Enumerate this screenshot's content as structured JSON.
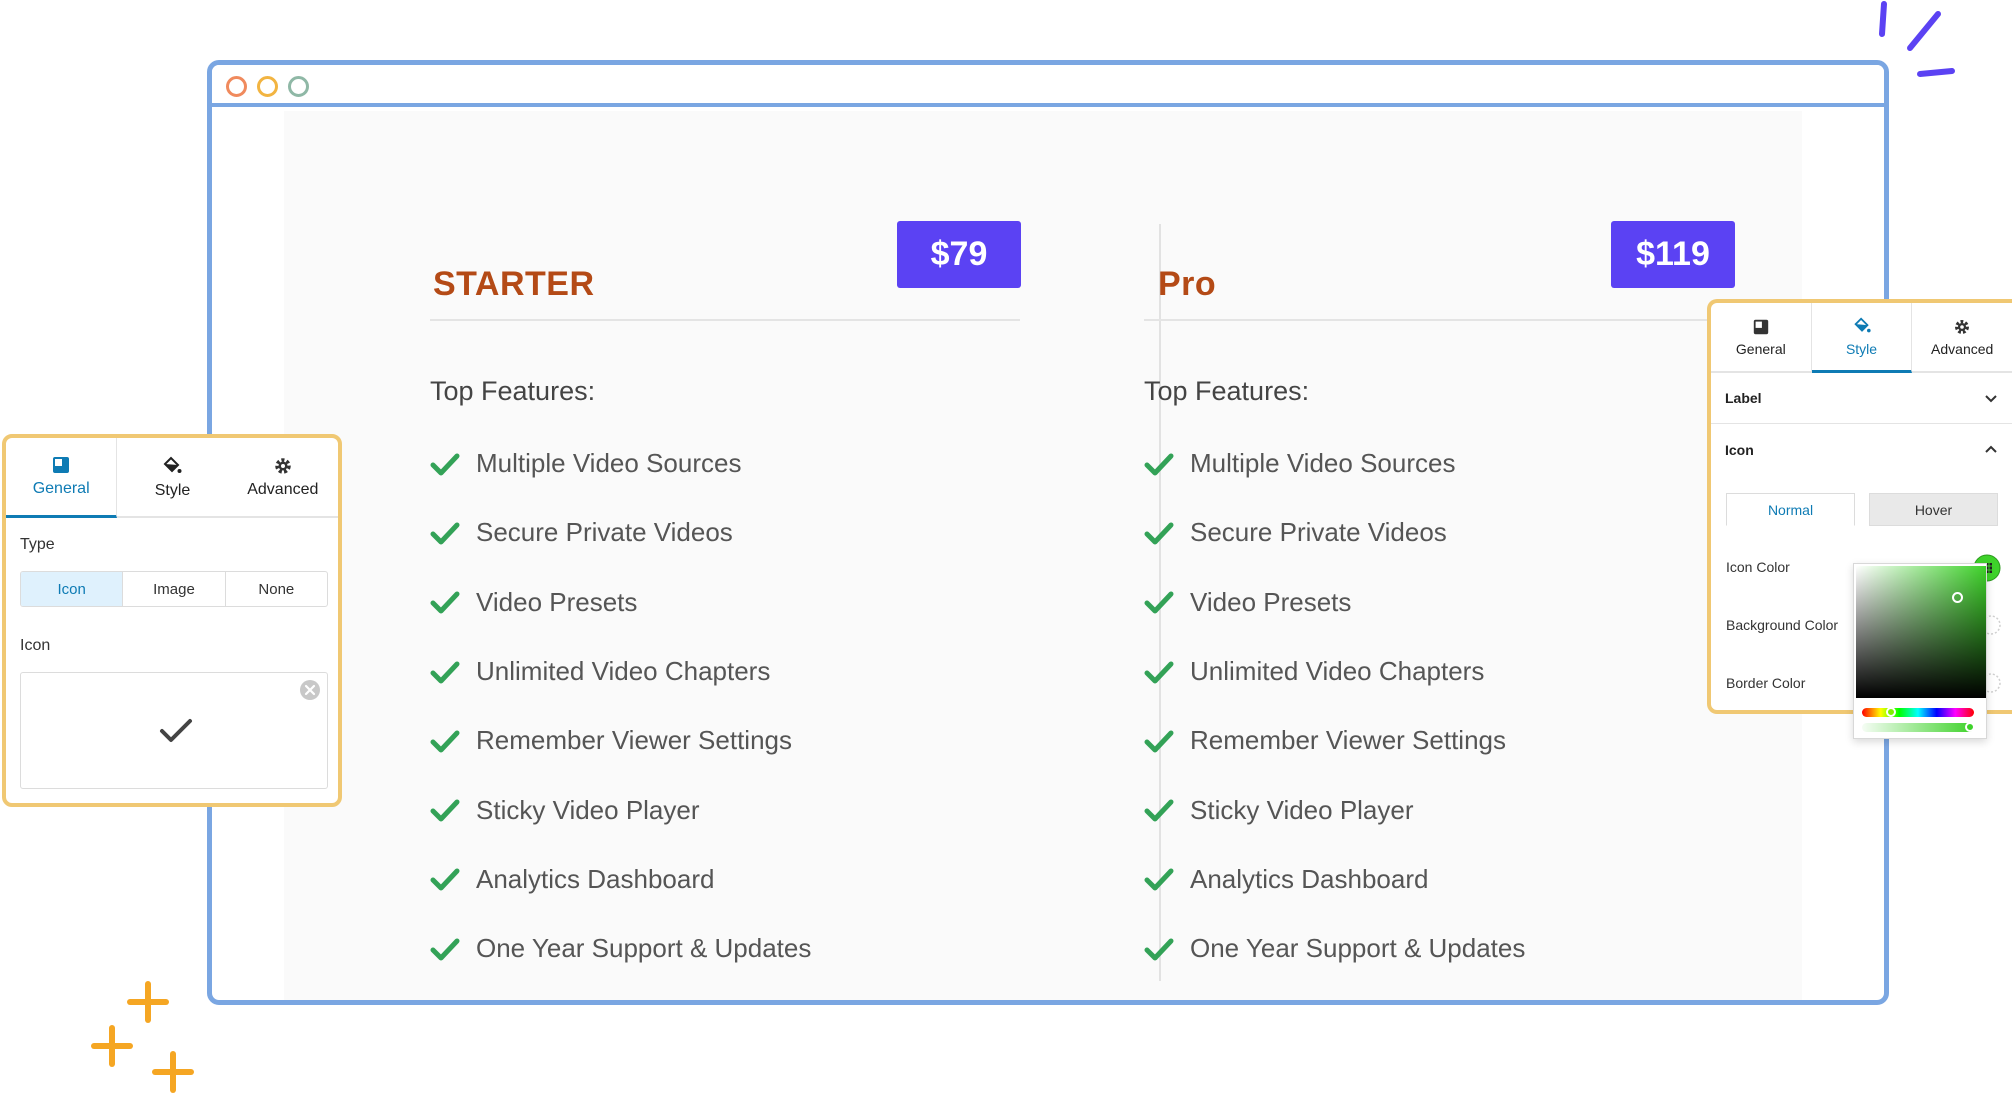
{
  "colors": {
    "browser_border": "#7aa6e2",
    "plan_name": "#b44a16",
    "price_badge": "#5b42f3",
    "check": "#33a257",
    "panel_border": "#f0c873",
    "active_tab": "#0e7bb4",
    "sparkle_orange": "#f5a623",
    "sparkle_purple": "#5b42f3"
  },
  "window": {
    "traffic_lights": [
      "#f08a5d",
      "#f2b441",
      "#8fb8a6"
    ]
  },
  "plans": [
    {
      "name": "STARTER",
      "price": "$79",
      "features_title": "Top Features:",
      "features": [
        "Multiple Video Sources",
        "Secure Private Videos",
        "Video Presets",
        "Unlimited Video Chapters",
        "Remember Viewer Settings",
        "Sticky Video Player",
        "Analytics Dashboard",
        "One Year Support & Updates"
      ]
    },
    {
      "name": "Pro",
      "price": "$119",
      "features_title": "Top Features:",
      "features": [
        "Multiple Video Sources",
        "Secure Private Videos",
        "Video Presets",
        "Unlimited Video Chapters",
        "Remember Viewer Settings",
        "Sticky Video Player",
        "Analytics Dashboard",
        "One Year Support & Updates"
      ]
    }
  ],
  "left_panel": {
    "tabs": [
      {
        "label": "General",
        "icon": "layout-icon",
        "active": true
      },
      {
        "label": "Style",
        "icon": "paint-bucket-icon",
        "active": false
      },
      {
        "label": "Advanced",
        "icon": "gear-icon",
        "active": false
      }
    ],
    "type_label": "Type",
    "type_options": [
      "Icon",
      "Image",
      "None"
    ],
    "type_selected": "Icon",
    "icon_label": "Icon",
    "icon_value": "checkmark-icon"
  },
  "right_panel": {
    "tabs": [
      {
        "label": "General",
        "icon": "layout-icon",
        "active": false
      },
      {
        "label": "Style",
        "icon": "paint-bucket-icon",
        "active": true
      },
      {
        "label": "Advanced",
        "icon": "gear-icon",
        "active": false
      }
    ],
    "sections": [
      {
        "label": "Label",
        "expanded": false
      },
      {
        "label": "Icon",
        "expanded": true
      }
    ],
    "states": [
      "Normal",
      "Hover"
    ],
    "state_selected": "Normal",
    "fields": [
      "Icon Color",
      "Background Color",
      "Border Color"
    ],
    "icon_color_swatch": "#3ed22a"
  }
}
